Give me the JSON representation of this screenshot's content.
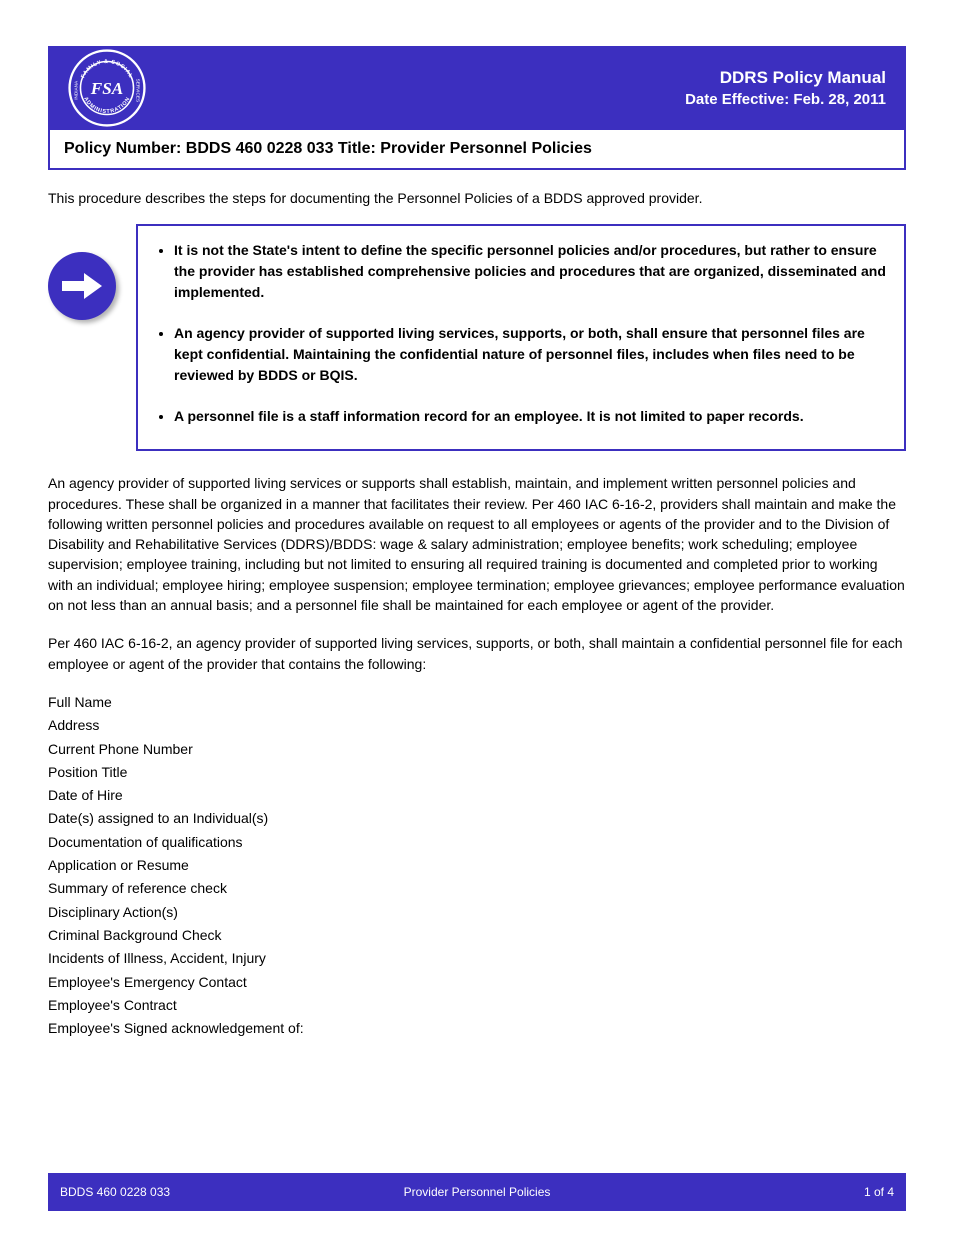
{
  "header": {
    "logo_alt": "Indiana Family & Social Services Administration FSSA seal",
    "title": "DDRS Policy Manual",
    "subtitle": "Date Effective: Feb. 28, 2011"
  },
  "sub_header": "Policy Number: BDDS 460 0228 033 Title: Provider Personnel Policies",
  "intro": "This procedure describes the steps for documenting the Personnel Policies of a BDDS approved provider.",
  "notes": [
    "It is not the State's intent to define the specific personnel policies and/or procedures, but rather to ensure the provider has established comprehensive policies and procedures that are organized, disseminated and implemented.",
    "An agency provider of supported living services, supports, or both, shall ensure that personnel files are kept confidential. Maintaining the confidential nature of personnel files, includes when files need to be reviewed by BDDS or BQIS.",
    "A personnel file is a staff information record for an employee. It is not limited to paper records."
  ],
  "paragraphs": [
    "An agency provider of supported living services or supports shall establish, maintain, and implement written personnel policies and procedures. These shall be organized in a manner that facilitates their review. Per 460 IAC 6-16-2, providers shall maintain and make the following written personnel policies and procedures available on request to all employees or agents of the provider and to the Division of Disability and Rehabilitative Services (DDRS)/BDDS: wage & salary administration; employee benefits; work scheduling; employee supervision; employee training, including but not limited to ensuring all required training is documented and completed prior to working with an individual; employee hiring; employee suspension; employee termination; employee grievances; employee performance evaluation on not less than an annual basis; and a personnel file shall be maintained for each employee or agent of the provider.",
    "Per 460 IAC 6-16-2, an agency provider of supported living services, supports, or both, shall maintain a confidential personnel file for each employee or agent of the provider that contains the following:"
  ],
  "fields": [
    "Full Name",
    "Address",
    "Current Phone Number",
    "Position Title",
    "Date of Hire",
    "Date(s) assigned to an Individual(s)",
    "Documentation of qualifications",
    "Application or Resume",
    "Summary of reference check",
    "Disciplinary Action(s)",
    "Criminal Background Check",
    "Incidents of Illness, Accident, Injury",
    "Employee's Emergency Contact",
    "Employee's Contract",
    "Employee's Signed acknowledgement of:"
  ],
  "footer": {
    "left": "BDDS 460 0228 033",
    "center": "Provider Personnel Policies",
    "right": "1 of 4"
  }
}
